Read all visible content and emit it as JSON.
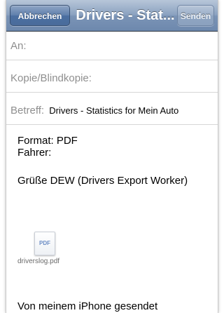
{
  "navbar": {
    "cancel_label": "Abbrechen",
    "title": "Drivers - Stat...",
    "send_label": "Senden"
  },
  "fields": {
    "to_label": "An:",
    "cc_label": "Kopie/Blindkopie:",
    "subject_label": "Betreff:",
    "subject_value": "Drivers - Statistics for Mein Auto"
  },
  "body": {
    "line1": "Format: PDF",
    "line2": "Fahrer:",
    "line3": "Grüße DEW (Drivers Export Worker)",
    "signature": "Von meinem iPhone gesendet"
  },
  "attachment": {
    "icon_text": "PDF",
    "filename": "driverslog.pdf"
  }
}
